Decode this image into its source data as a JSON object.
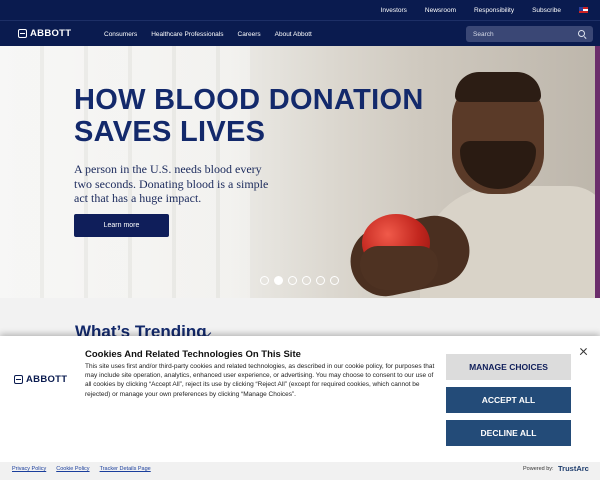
{
  "utility_nav": {
    "links": [
      "Investors",
      "Newsroom",
      "Responsibility",
      "Subscribe"
    ],
    "flag_icon": "us-flag-icon"
  },
  "main_nav": {
    "logo": "ABBOTT",
    "links": [
      "Consumers",
      "Healthcare Professionals",
      "Careers",
      "About Abbott"
    ],
    "search_placeholder": "Search"
  },
  "hero": {
    "title": "HOW BLOOD DONATION SAVES LIVES",
    "text": "A person in the U.S. needs blood every two seconds. Donating blood is a simple act that has a huge impact.",
    "button": "Learn more",
    "slide_count": 6,
    "active_slide": 2
  },
  "trending": {
    "heading": "What’s Trending"
  },
  "cookie_banner": {
    "logo": "ABBOTT",
    "title": "Cookies And Related Technologies On This Site",
    "body": "This site uses first and/or third-party cookies and related technologies, as described in our cookie policy, for purposes that may include site operation, analytics, enhanced user experience, or advertising. You may choose to consent to our use of all cookies by clicking “Accept All”, reject its use by clicking “Reject All” (except for required cookies, which cannot be rejected) or manage your own preferences by clicking “Manage Choices”.",
    "manage_button": "MANAGE CHOICES",
    "accept_button": "ACCEPT ALL",
    "decline_button": "DECLINE ALL",
    "footer_links": [
      "Privacy Policy",
      "Cookie Policy",
      "Tracker Details Page"
    ],
    "powered_by": "Powered by:",
    "trustarc": "TrustArc"
  },
  "colors": {
    "navy": "#0a1b4f",
    "hero_text": "#13296b",
    "button_blue": "#234b78",
    "link_blue": "#1a3e9c"
  }
}
